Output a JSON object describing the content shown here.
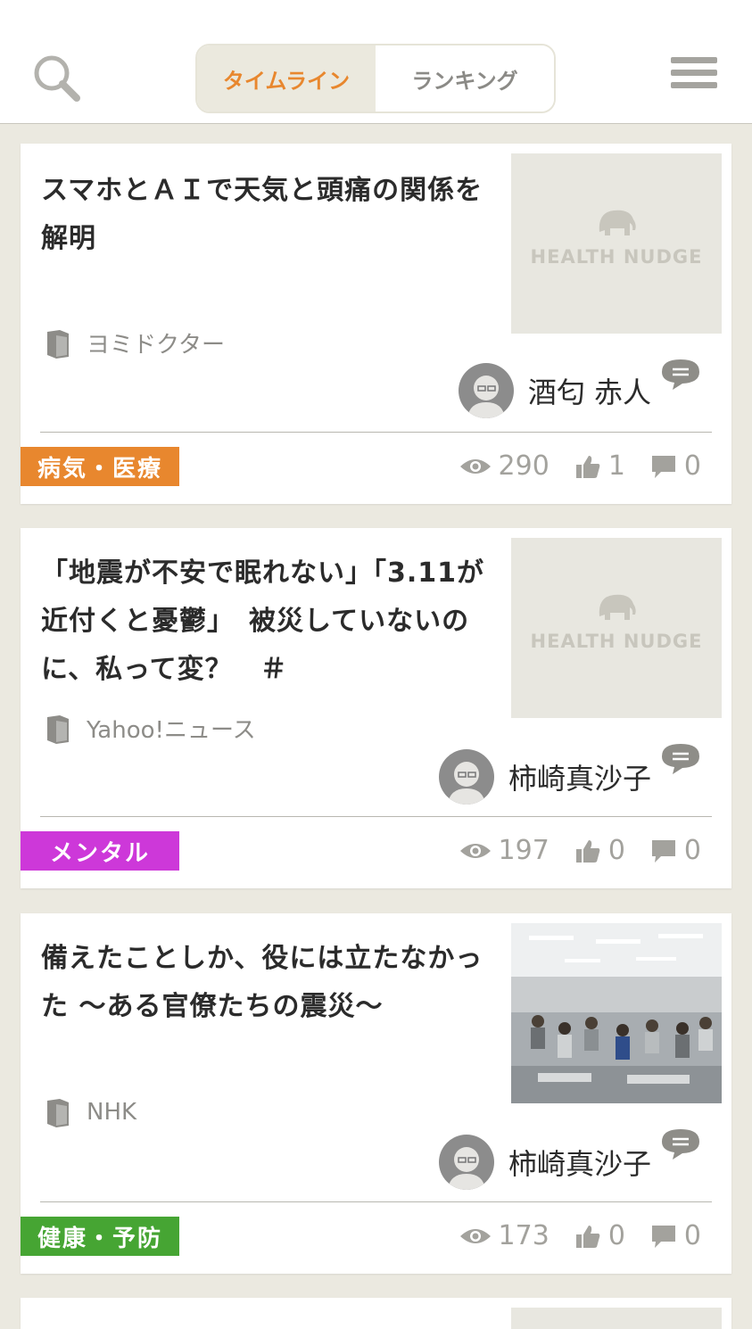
{
  "tabs": [
    {
      "label": "タイムライン",
      "active": true
    },
    {
      "label": "ランキング",
      "active": false
    }
  ],
  "colors": {
    "accent": "#e8872e",
    "background": "#ebe9e0",
    "tag_disease": "#e8872e",
    "tag_mental": "#cd38d9",
    "tag_health": "#46a533"
  },
  "icons": [
    "search-icon",
    "menu-icon",
    "book-icon",
    "comment-bubble-icon",
    "eye-icon",
    "thumbs-up-icon",
    "comment-icon",
    "elephant-logo-icon"
  ],
  "placeholder_logo": "HEALTH NUDGE",
  "articles": [
    {
      "title": "スマホとＡＩで天気と頭痛の関係を解明",
      "source": "ヨミドクター",
      "author": "酒匂 赤人",
      "tag": "病気・医療",
      "views": "290",
      "likes": "1",
      "comments": "0"
    },
    {
      "title": "「地震が不安で眠れない」「3.11が近付くと憂鬱」　被災していないのに、私って変？　＃",
      "source": "Yahoo!ニュース",
      "author": "柿崎真沙子",
      "tag": "メンタル",
      "views": "197",
      "likes": "0",
      "comments": "0"
    },
    {
      "title": "備えたことしか、役には立たなかった ～ある官僚たちの震災～",
      "source": "NHK",
      "author": "柿崎真沙子",
      "tag": "健康・予防",
      "views": "173",
      "likes": "0",
      "comments": "0"
    }
  ]
}
